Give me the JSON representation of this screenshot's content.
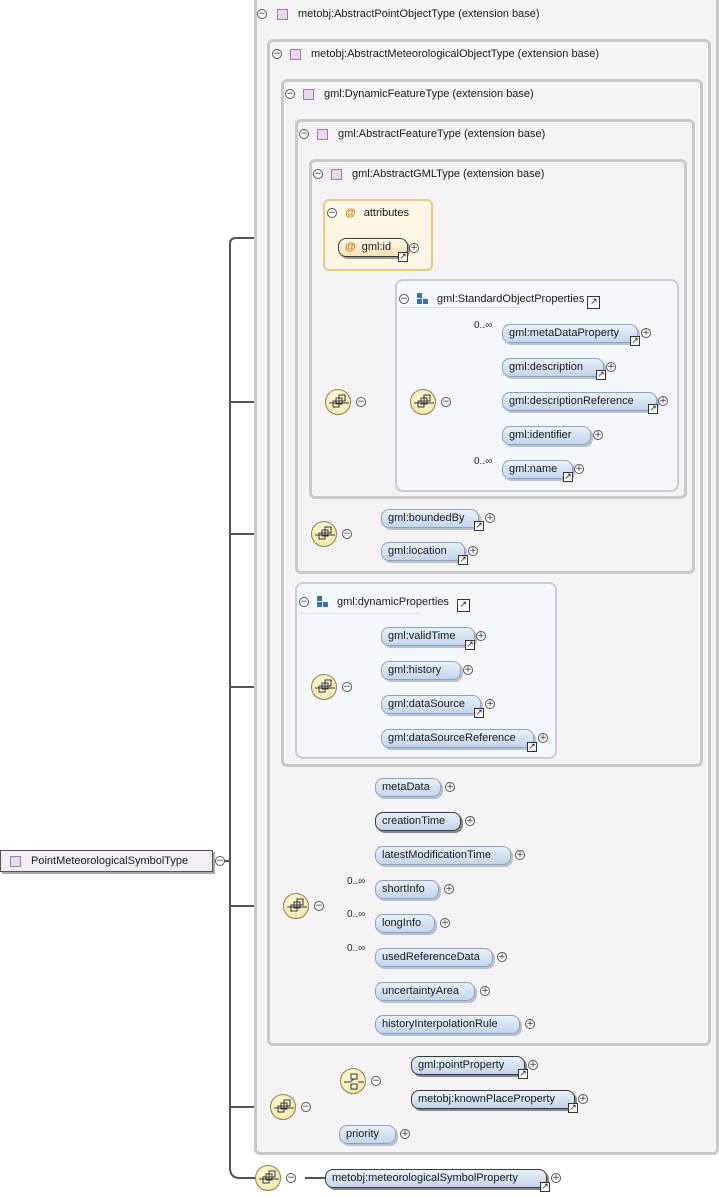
{
  "root": {
    "label": "PointMeteorologicalSymbolType",
    "icon": "complex-type-icon"
  },
  "bases": {
    "point_object": "metobj:AbstractPointObjectType (extension base)",
    "meteorological_object": "metobj:AbstractMeteorologicalObjectType (extension base)",
    "dynamic_feature": "gml:DynamicFeatureType (extension base)",
    "abstract_feature": "gml:AbstractFeatureType (extension base)",
    "abstract_gml": "gml:AbstractGMLType (extension base)"
  },
  "attributes": {
    "title": "attributes",
    "items": [
      "gml:id"
    ]
  },
  "groups": {
    "standard_object_properties": {
      "title": "gml:StandardObjectProperties",
      "elements": [
        "gml:metaDataProperty",
        "gml:description",
        "gml:descriptionReference",
        "gml:identifier",
        "gml:name"
      ],
      "cardinalities": [
        "0..∞",
        "",
        "",
        "",
        "0..∞"
      ]
    },
    "bounded": {
      "elements": [
        "gml:boundedBy",
        "gml:location"
      ]
    },
    "dynamic_properties": {
      "title": "gml:dynamicProperties",
      "elements": [
        "gml:validTime",
        "gml:history",
        "gml:dataSource",
        "gml:dataSourceReference"
      ]
    }
  },
  "meteorological_elements": [
    "metaData",
    "creationTime",
    "latestModificationTime",
    "shortInfo",
    "longInfo",
    "usedReferenceData",
    "uncertaintyArea",
    "historyInterpolationRule"
  ],
  "meteorological_cardinalities": [
    "",
    "",
    "",
    "0..∞",
    "0..∞",
    "0..∞",
    "",
    ""
  ],
  "point_choice": [
    "gml:pointProperty",
    "metobj:knownPlaceProperty"
  ],
  "priority": "priority",
  "symbol_property": "metobj:meteorologicalSymbolProperty",
  "symbols": {
    "collapse": "−",
    "expand": "+",
    "link": "↗",
    "at": "@"
  },
  "colors": {
    "complex_type": "#e9d9ee",
    "element": "#c3d5ee",
    "attribute": "#f7e2b3",
    "compositor": "#f0e19a"
  }
}
